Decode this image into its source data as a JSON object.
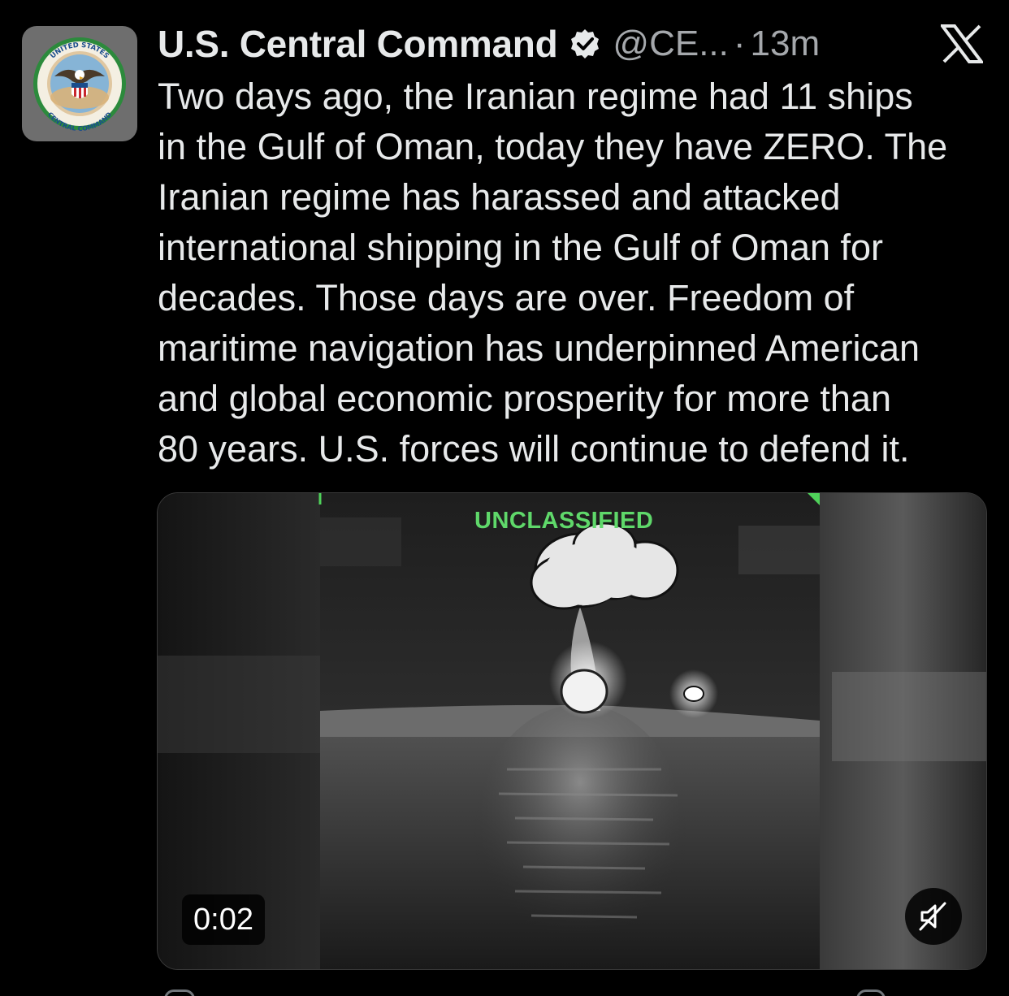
{
  "post": {
    "display_name": "U.S. Central Command",
    "handle": "@CE...",
    "separator": "·",
    "time": "13m",
    "text": "Two days ago, the Iranian regime had 11 ships\nin the Gulf of Oman, today they have ZERO. The\nIranian regime has harassed and attacked\ninternational shipping in the Gulf of Oman for\ndecades. Those days are over. Freedom of\nmaritime navigation has underpinned American\nand global economic prosperity for more than\n80 years. U.S. forces will continue to defend it."
  },
  "avatar": {
    "icon": "central-command-seal-icon",
    "seal_top_text": "UNITED STATES",
    "seal_bottom_text": "CENTRAL COMMAND"
  },
  "verified_icon": "verified-badge-icon",
  "platform_icon": "x-logo-icon",
  "media": {
    "classification_label": "UNCLASSIFIED",
    "duration": "0:02",
    "mute_icon": "muted-speaker-icon"
  },
  "colors": {
    "background": "#000000",
    "text_primary": "#e7e9ea",
    "text_secondary": "#a5a8ac",
    "overlay_green": "#5fd86a"
  }
}
